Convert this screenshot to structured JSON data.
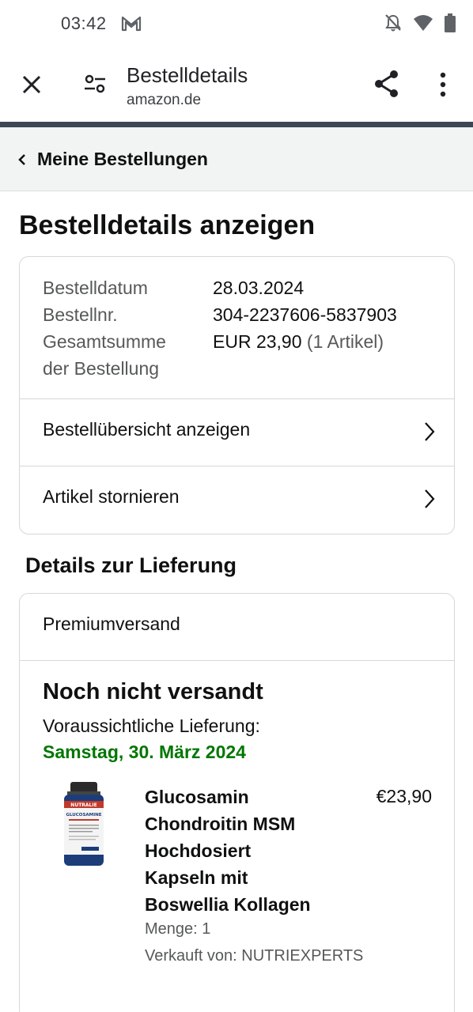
{
  "status_bar": {
    "time": "03:42",
    "icons": [
      "gmail-icon",
      "bell-off-icon",
      "wifi-icon",
      "battery-icon"
    ]
  },
  "toolbar": {
    "title": "Bestelldetails",
    "url": "amazon.de",
    "icons": [
      "close-icon",
      "page-settings-icon",
      "share-icon",
      "more-vert-icon"
    ]
  },
  "back_nav": {
    "label": "Meine Bestellungen"
  },
  "page": {
    "title": "Bestelldetails anzeigen"
  },
  "order_info": {
    "date_label": "Bestelldatum",
    "date_value": "28.03.2024",
    "number_label": "Bestellnr.",
    "number_value": "304-2237606-5837903",
    "total_label_line1": "Gesamtsumme",
    "total_label_line2": "der Bestellung",
    "total_value": "EUR 23,90",
    "total_count": "(1 Artikel)"
  },
  "order_actions": [
    {
      "label": "Bestellübersicht anzeigen"
    },
    {
      "label": "Artikel stornieren"
    }
  ],
  "delivery": {
    "section_title": "Details zur Lieferung",
    "method": "Premiumversand",
    "status": "Noch nicht versandt",
    "estimate_label": "Voraussichtliche Lieferung:",
    "estimate_date": "Samstag, 30. März 2024"
  },
  "product": {
    "name_lines": [
      "Glucosamin",
      "Chondroitin MSM",
      "Hochdosiert",
      "Kapseln mit",
      "Boswellia Kollagen"
    ],
    "price": "€23,90",
    "quantity": "Menge: 1",
    "seller": "Verkauft von: NUTRIEXPERTS",
    "image_brand": "NUTRALIE",
    "image_product": "GLUCOSAMINE",
    "colors": {
      "label": "#c0392b",
      "cap": "#2b2b2b",
      "bottle": "#1c3d7a"
    }
  },
  "colors": {
    "delivery_date": "#007600",
    "toolbar_line": "#3c4654",
    "back_nav_bg": "#f2f3f3",
    "border": "#d5d9d9"
  }
}
